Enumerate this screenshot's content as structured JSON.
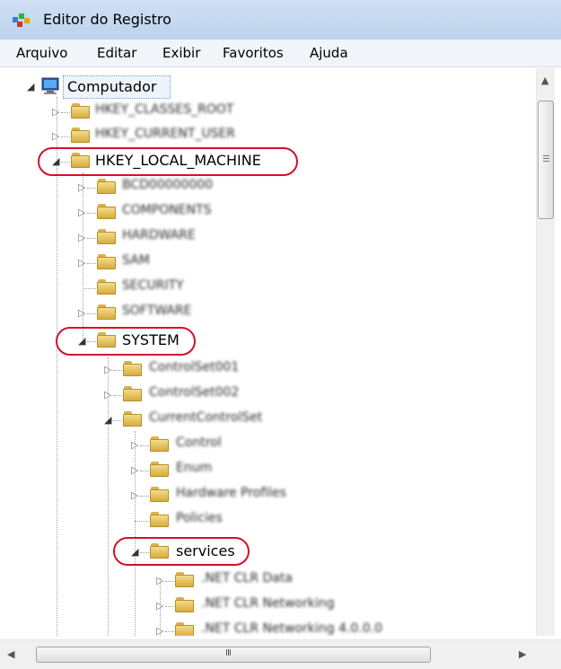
{
  "window": {
    "title": "Editor do Registro"
  },
  "menu": [
    "Arquivo",
    "Editar",
    "Exibir",
    "Favoritos",
    "Ajuda"
  ],
  "tree": {
    "root": "Computador",
    "hkcr": "HKEY_CLASSES_ROOT",
    "hkcu": "HKEY_CURRENT_USER",
    "hklm": "HKEY_LOCAL_MACHINE",
    "bcd": "BCD00000000",
    "components": "COMPONENTS",
    "hardware": "HARDWARE",
    "sam": "SAM",
    "security": "SECURITY",
    "software": "SOFTWARE",
    "system": "SYSTEM",
    "cs001": "ControlSet001",
    "cs002": "ControlSet002",
    "ccs": "CurrentControlSet",
    "control": "Control",
    "enum": "Enum",
    "hwprofiles": "Hardware Profiles",
    "policies": "Policies",
    "services": "services",
    "netclrdata": ".NET CLR Data",
    "netclrnet": ".NET CLR Networking",
    "netclrnet4": ".NET CLR Networking 4.0.0.0"
  },
  "scrollbar": {
    "grip": "III"
  },
  "colors": {
    "highlight": "#d3102a",
    "titlebar": "#c4d8ee",
    "folder": "#e8c25a"
  }
}
